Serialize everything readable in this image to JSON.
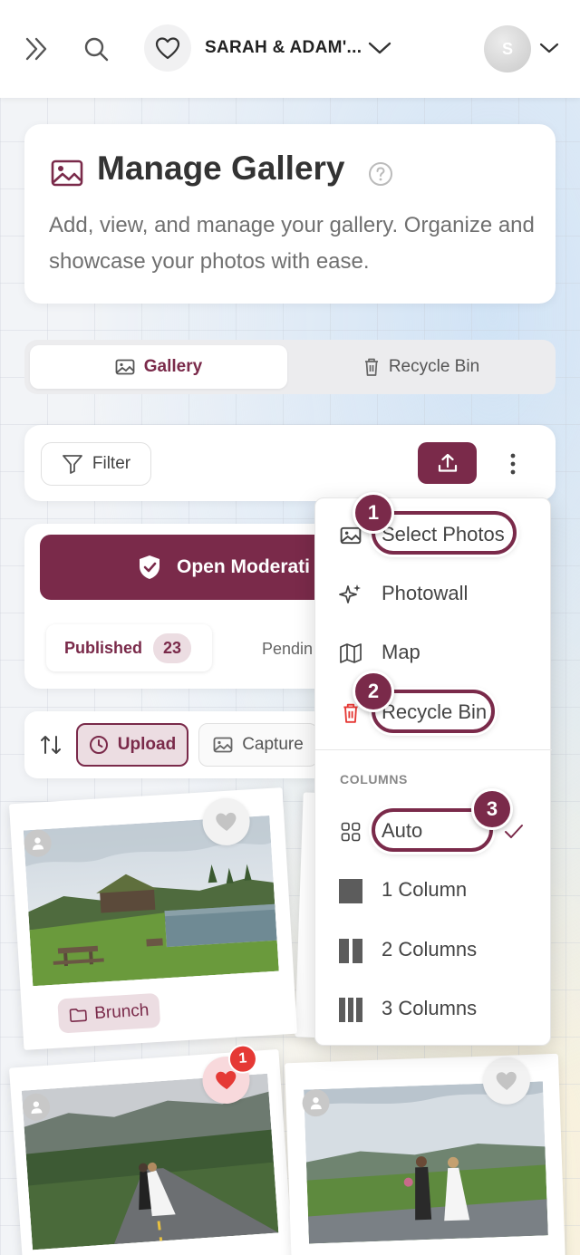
{
  "topbar": {
    "event_title": "SARAH & ADAM'...",
    "avatar_initial": "S"
  },
  "header": {
    "title": "Manage Gallery",
    "description": "Add, view, and manage your gallery. Organize and showcase your photos with ease."
  },
  "tabs": [
    {
      "label": "Gallery",
      "active": true
    },
    {
      "label": "Recycle Bin",
      "active": false
    }
  ],
  "toolbar": {
    "filter_label": "Filter"
  },
  "moderation": {
    "button_label": "Open Moderati",
    "published_label": "Published",
    "published_count": "23",
    "pending_label": "Pendin"
  },
  "sort": {
    "upload_label": "Upload",
    "capture_label": "Capture"
  },
  "photos": [
    {
      "album": "Brunch",
      "liked": false
    },
    {
      "album": "",
      "liked": true,
      "like_count": "1"
    },
    {
      "album": "",
      "liked": false
    }
  ],
  "menu": {
    "items": [
      {
        "label": "Select Photos",
        "icon": "image-icon",
        "annotation": "1"
      },
      {
        "label": "Photowall",
        "icon": "sparkles-icon"
      },
      {
        "label": "Map",
        "icon": "map-icon"
      },
      {
        "label": "Recycle Bin",
        "icon": "trash-icon",
        "annotation": "2"
      }
    ],
    "columns_header": "COLUMNS",
    "columns": [
      {
        "label": "Auto",
        "icon": "grid-icon",
        "selected": true,
        "annotation": "3"
      },
      {
        "label": "1 Column",
        "icon": "one-column-icon"
      },
      {
        "label": "2 Columns",
        "icon": "two-columns-icon"
      },
      {
        "label": "3 Columns",
        "icon": "three-columns-icon"
      }
    ]
  },
  "colors": {
    "brand": "#7a2a4a",
    "brand_light": "#ecdde2",
    "danger": "#e53935"
  }
}
